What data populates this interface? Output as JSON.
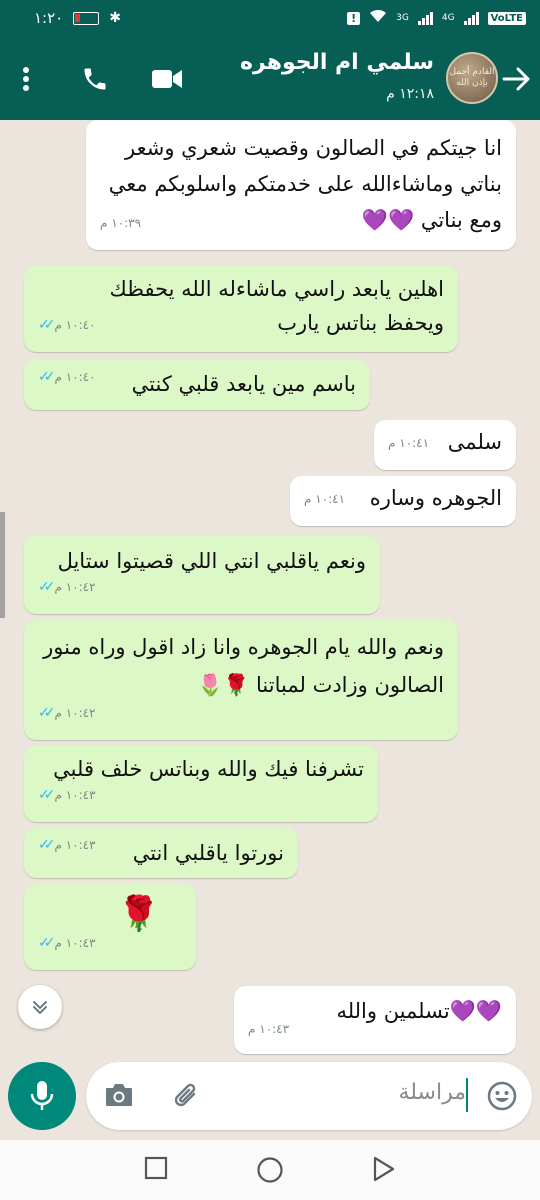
{
  "status_bar": {
    "time": "١:٢٠",
    "network": "4G",
    "network2": "3G",
    "volte": "VoLTE"
  },
  "header": {
    "contact_name": "سلمي ام الجوهره",
    "last_seen": "١٢:١٨ م",
    "avatar_text": "القادم أجمل بإذن الله"
  },
  "messages": [
    {
      "dir": "in",
      "text": "انا جيتكم في الصالون وقصيت شعري وشعر بناتي وماشاءالله على خدمتكم واسلوبكم معي ومع بناتي 💜💜",
      "time": "١٠:٣٩ م"
    },
    {
      "dir": "out",
      "text": "اهلين يابعد راسي ماشاءله الله يحفظك ويحفظ بناتس يارب",
      "time": "١٠:٤٠ م"
    },
    {
      "dir": "out",
      "text": "باسم مين يابعد قلبي كنتي",
      "time": "١٠:٤٠ م"
    },
    {
      "dir": "in",
      "text": "سلمى",
      "time": "١٠:٤١ م"
    },
    {
      "dir": "in",
      "text": "الجوهره وساره",
      "time": "١٠:٤١ م"
    },
    {
      "dir": "out",
      "text": "ونعم ياقلبي انتي اللي قصيتوا ستايل",
      "time": "١٠:٤٢ م"
    },
    {
      "dir": "out",
      "text": "ونعم والله يام الجوهره وانا زاد اقول وراه منور الصالون وزادت لمباتنا 🌹🌷",
      "time": "١٠:٤٢ م"
    },
    {
      "dir": "out",
      "text": "تشرفنا فيك والله وبناتس خلف قلبي",
      "time": "١٠:٤٣ م"
    },
    {
      "dir": "out",
      "text": "نورتوا ياقلبي انتي",
      "time": "١٠:٤٣ م"
    },
    {
      "dir": "out",
      "text": "🌹",
      "time": "١٠:٤٣ م"
    },
    {
      "dir": "in",
      "text": "💜💜تسلمين والله",
      "time": "١٠:٤٣ م"
    }
  ],
  "input": {
    "placeholder": "مراسلة"
  },
  "colors": {
    "header": "#075e54",
    "outgoing": "#dcf8c6",
    "incoming": "#ffffff",
    "accent": "#00897b",
    "read_ticks": "#34b7f1"
  },
  "icons": [
    "back-arrow-icon",
    "video-call-icon",
    "voice-call-icon",
    "more-menu-icon",
    "scroll-down-icon",
    "mic-icon",
    "camera-icon",
    "attach-icon",
    "emoji-icon",
    "nav-recent-icon",
    "nav-home-icon",
    "nav-back-icon"
  ]
}
